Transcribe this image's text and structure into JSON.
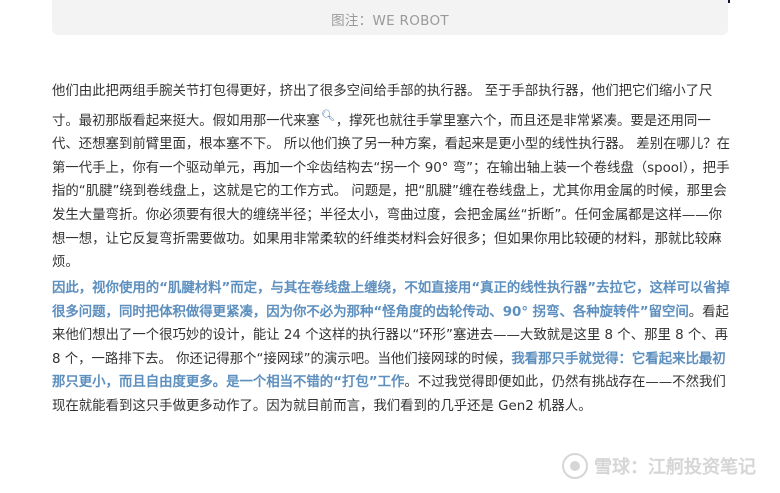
{
  "image": {
    "caption": "图注：WE ROBOT"
  },
  "paragraph1": {
    "before_link": "他们由此把两组手腕关节打包得更好，挤出了很多空间给手部的执行器。 至于手部执行器，他们把它们缩小了尺寸。最初那版看起来挺大。假如用那一代",
    "link_text": "来塞",
    "after_link": "，撑死也就往手掌里塞六个，而且还是非常紧凑。要是还用同一代、还想塞到前臂里面，根本塞不下。 所以他们换了另一种方案，看起来是更小型的线性执行器。 差别在哪儿？在第一代手上，你有一个驱动单元，再加一个伞齿结构去“拐一个 90° 弯”；在输出轴上装一个卷线盘（spool），把手指的“肌腱”绕到卷线盘上，这就是它的工作方式。 问题是，把“肌腱”缠在卷线盘上，尤其你用金属的时候，那里会发生大量弯折。你必须要有很大的缠绕半径；半径太小，弯曲过度，会把金属丝“折断”。任何金属都是这样——你想一想，让它反复弯折需要做功。如果用非常柔软的纤维类材料会好很多；但如果你用比较硬的材料，那就比较麻烦。"
  },
  "paragraph2": {
    "highlight1": "因此，视你使用的“肌腱材料”而定，与其在卷线盘上缠绕，不如直接用“真正的线性执行器”去拉它，这样可以省掉很多问题，同时把体积做得更紧凑，因为你不必为那种“怪角度的齿轮传动、90° 拐弯、各种旋转件”留空间",
    "normal1": "。看起来他们想出了一个很巧妙的设计，能让 24 个这样的执行器以“环形”塞进去——大致就是这里 8 个、那里 8 个、再 8 个，一路排下去。 你还记得那个“接网球”的演示吧。当他们接网球的时候，",
    "highlight2": "我看那只手就觉得：它看起来比最初那只更小，而且自由度更多。是一个相当不错的“打包”工作",
    "normal2": "。不过我觉得即便如此，仍然有挑战存在——不然我们现在就能看到这只手做更多动作了。因为就目前而言，我们看到的几乎还是 Gen2 机器人。"
  },
  "watermark": {
    "text": "雪球：江舸投资笔记"
  },
  "colors": {
    "highlight": "#5d8fbf",
    "body_text": "#333333",
    "caption": "#9a9a9a",
    "link": "#3f6fb4"
  }
}
